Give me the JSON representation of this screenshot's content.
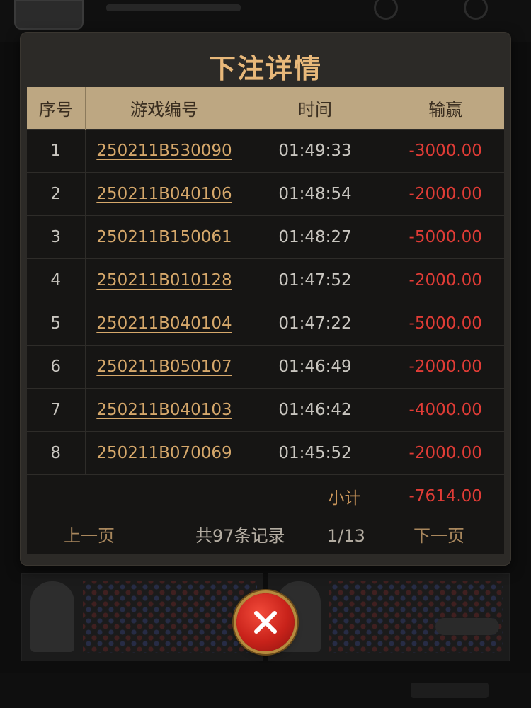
{
  "modal": {
    "title": "下注详情",
    "columns": [
      "序号",
      "游戏编号",
      "时间",
      "输赢"
    ],
    "rows": [
      {
        "index": "1",
        "game_id": "250211B530090",
        "time": "01:49:33",
        "amount": "-3000.00"
      },
      {
        "index": "2",
        "game_id": "250211B040106",
        "time": "01:48:54",
        "amount": "-2000.00"
      },
      {
        "index": "3",
        "game_id": "250211B150061",
        "time": "01:48:27",
        "amount": "-5000.00"
      },
      {
        "index": "4",
        "game_id": "250211B010128",
        "time": "01:47:52",
        "amount": "-2000.00"
      },
      {
        "index": "5",
        "game_id": "250211B040104",
        "time": "01:47:22",
        "amount": "-5000.00"
      },
      {
        "index": "6",
        "game_id": "250211B050107",
        "time": "01:46:49",
        "amount": "-2000.00"
      },
      {
        "index": "7",
        "game_id": "250211B040103",
        "time": "01:46:42",
        "amount": "-4000.00"
      },
      {
        "index": "8",
        "game_id": "250211B070069",
        "time": "01:45:52",
        "amount": "-2000.00"
      }
    ],
    "subtotal_label": "小计",
    "subtotal_value": "-7614.00",
    "pager": {
      "prev_label": "上一页",
      "record_count": "共97条记录",
      "page_indicator": "1/13",
      "next_label": "下一页"
    }
  },
  "close_button": {
    "icon": "close-icon"
  },
  "colors": {
    "title": "#e8b87a",
    "header_bg": "#bda782",
    "game_id_link": "#d6a86b",
    "negative_amount": "#e13c36",
    "panel_bg": "#2c2a27"
  }
}
